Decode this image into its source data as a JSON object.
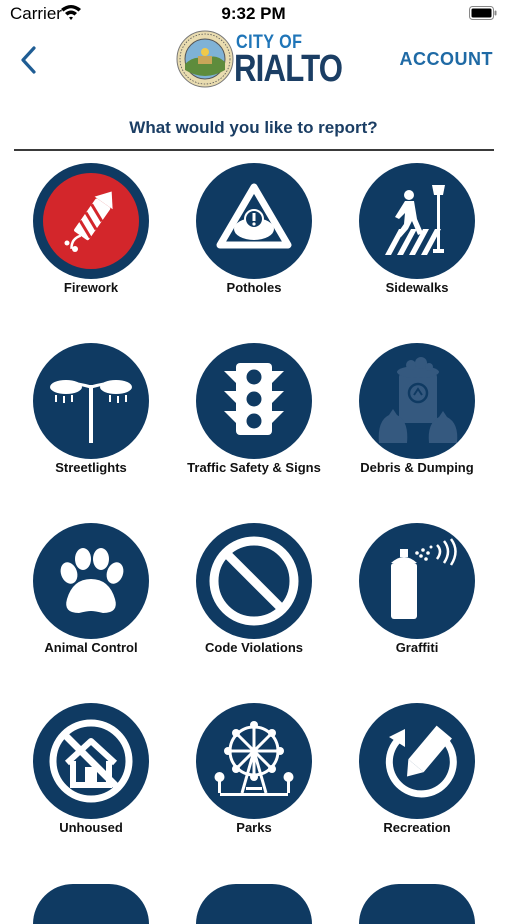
{
  "status": {
    "carrier": "Carrier",
    "time": "9:32 PM"
  },
  "nav": {
    "account_label": "ACCOUNT",
    "logo_city": "CITY OF",
    "logo_name": "RIALTO"
  },
  "prompt": "What would you like to report?",
  "colors": {
    "navy": "#0f3a62",
    "firework_red": "#d3262b",
    "link_blue": "#1f6aa5"
  },
  "categories": [
    {
      "label": "Firework",
      "icon": "firework-icon"
    },
    {
      "label": "Potholes",
      "icon": "pothole-warning-icon"
    },
    {
      "label": "Sidewalks",
      "icon": "pedestrian-crosswalk-icon"
    },
    {
      "label": "Streetlights",
      "icon": "streetlight-icon"
    },
    {
      "label": "Traffic Safety & Signs",
      "icon": "traffic-light-icon"
    },
    {
      "label": "Debris & Dumping",
      "icon": "trash-bags-icon"
    },
    {
      "label": "Animal Control",
      "icon": "paw-print-icon"
    },
    {
      "label": "Code Violations",
      "icon": "prohibited-icon"
    },
    {
      "label": "Graffiti",
      "icon": "spray-can-icon"
    },
    {
      "label": "Unhoused",
      "icon": "no-house-icon"
    },
    {
      "label": "Parks",
      "icon": "ferris-wheel-icon"
    },
    {
      "label": "Recreation",
      "icon": "recreation-refresh-pencil-icon"
    }
  ]
}
